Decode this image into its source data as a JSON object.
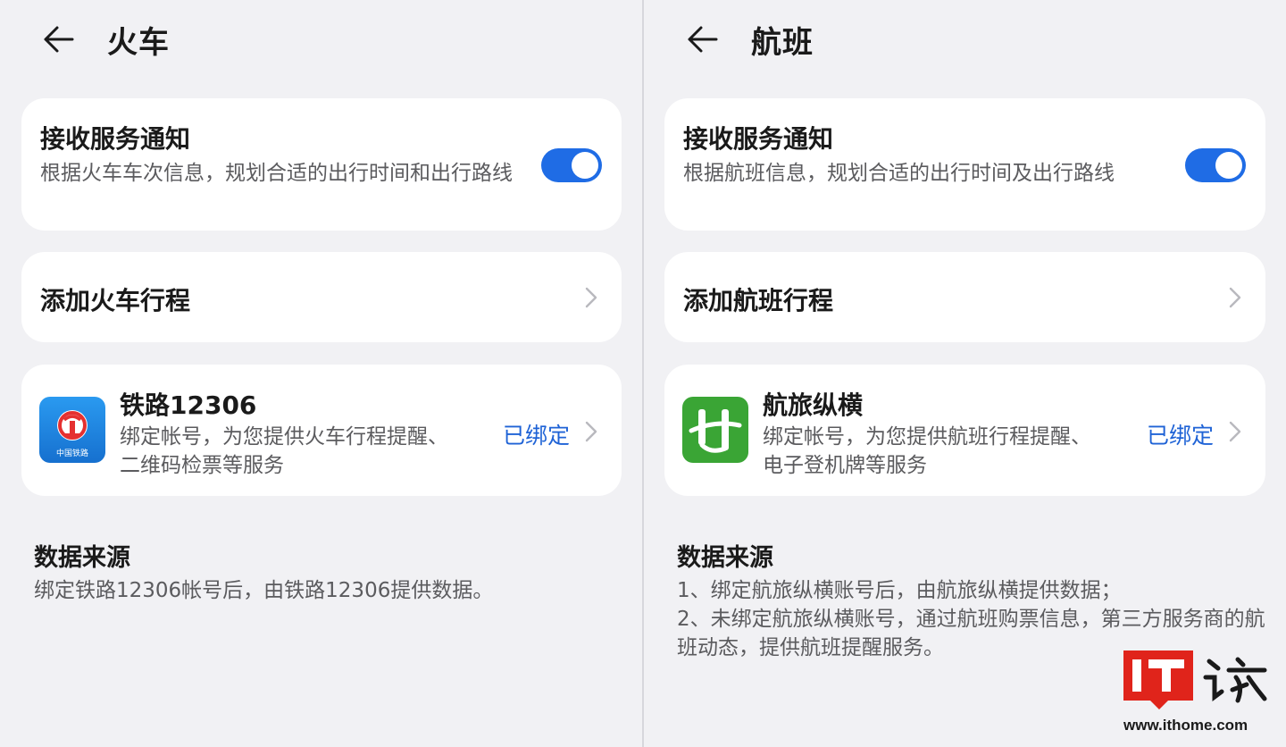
{
  "train": {
    "title": "火车",
    "notify": {
      "title": "接收服务通知",
      "description": "根据火车车次信息，规划合适的出行时间和出行路线",
      "enabled": true
    },
    "add_trip_label": "添加火车行程",
    "account": {
      "name": "铁路12306",
      "description": "绑定帐号，为您提供火车行程提醒、二维码检票等服务",
      "status": "已绑定",
      "icon_caption": "中国铁路"
    },
    "source": {
      "title": "数据来源",
      "lines": [
        "绑定铁路12306帐号后，由铁路12306提供数据。"
      ]
    }
  },
  "flight": {
    "title": "航班",
    "notify": {
      "title": "接收服务通知",
      "description": "根据航班信息，规划合适的出行时间及出行路线",
      "enabled": true
    },
    "add_trip_label": "添加航班行程",
    "account": {
      "name": "航旅纵横",
      "description": "绑定帐号，为您提供航班行程提醒、电子登机牌等服务",
      "status": "已绑定"
    },
    "source": {
      "title": "数据来源",
      "lines": [
        "1、绑定航旅纵横账号后，由航旅纵横提供数据；",
        "2、未绑定航旅纵横账号，通过航班购票信息，第三方服务商的航班动态，提供航班提醒服务。"
      ]
    }
  },
  "watermark": {
    "logo_text": "IT之家",
    "url": "www.ithome.com"
  },
  "colors": {
    "accent": "#1f6ce5",
    "bound_text": "#1f63d6",
    "background": "#f1f1f4",
    "card": "#ffffff",
    "railway_icon_bg": "#1a87e0",
    "railway_logo": "#e53030",
    "hanglv_icon_bg": "#3aa535",
    "watermark_red": "#e0241b"
  },
  "icons": {
    "back": "arrow-left-icon",
    "chevron": "chevron-right-icon",
    "railway_app": "china-railway-logo-icon",
    "flight_app": "hanglv-zongheng-logo-icon"
  }
}
